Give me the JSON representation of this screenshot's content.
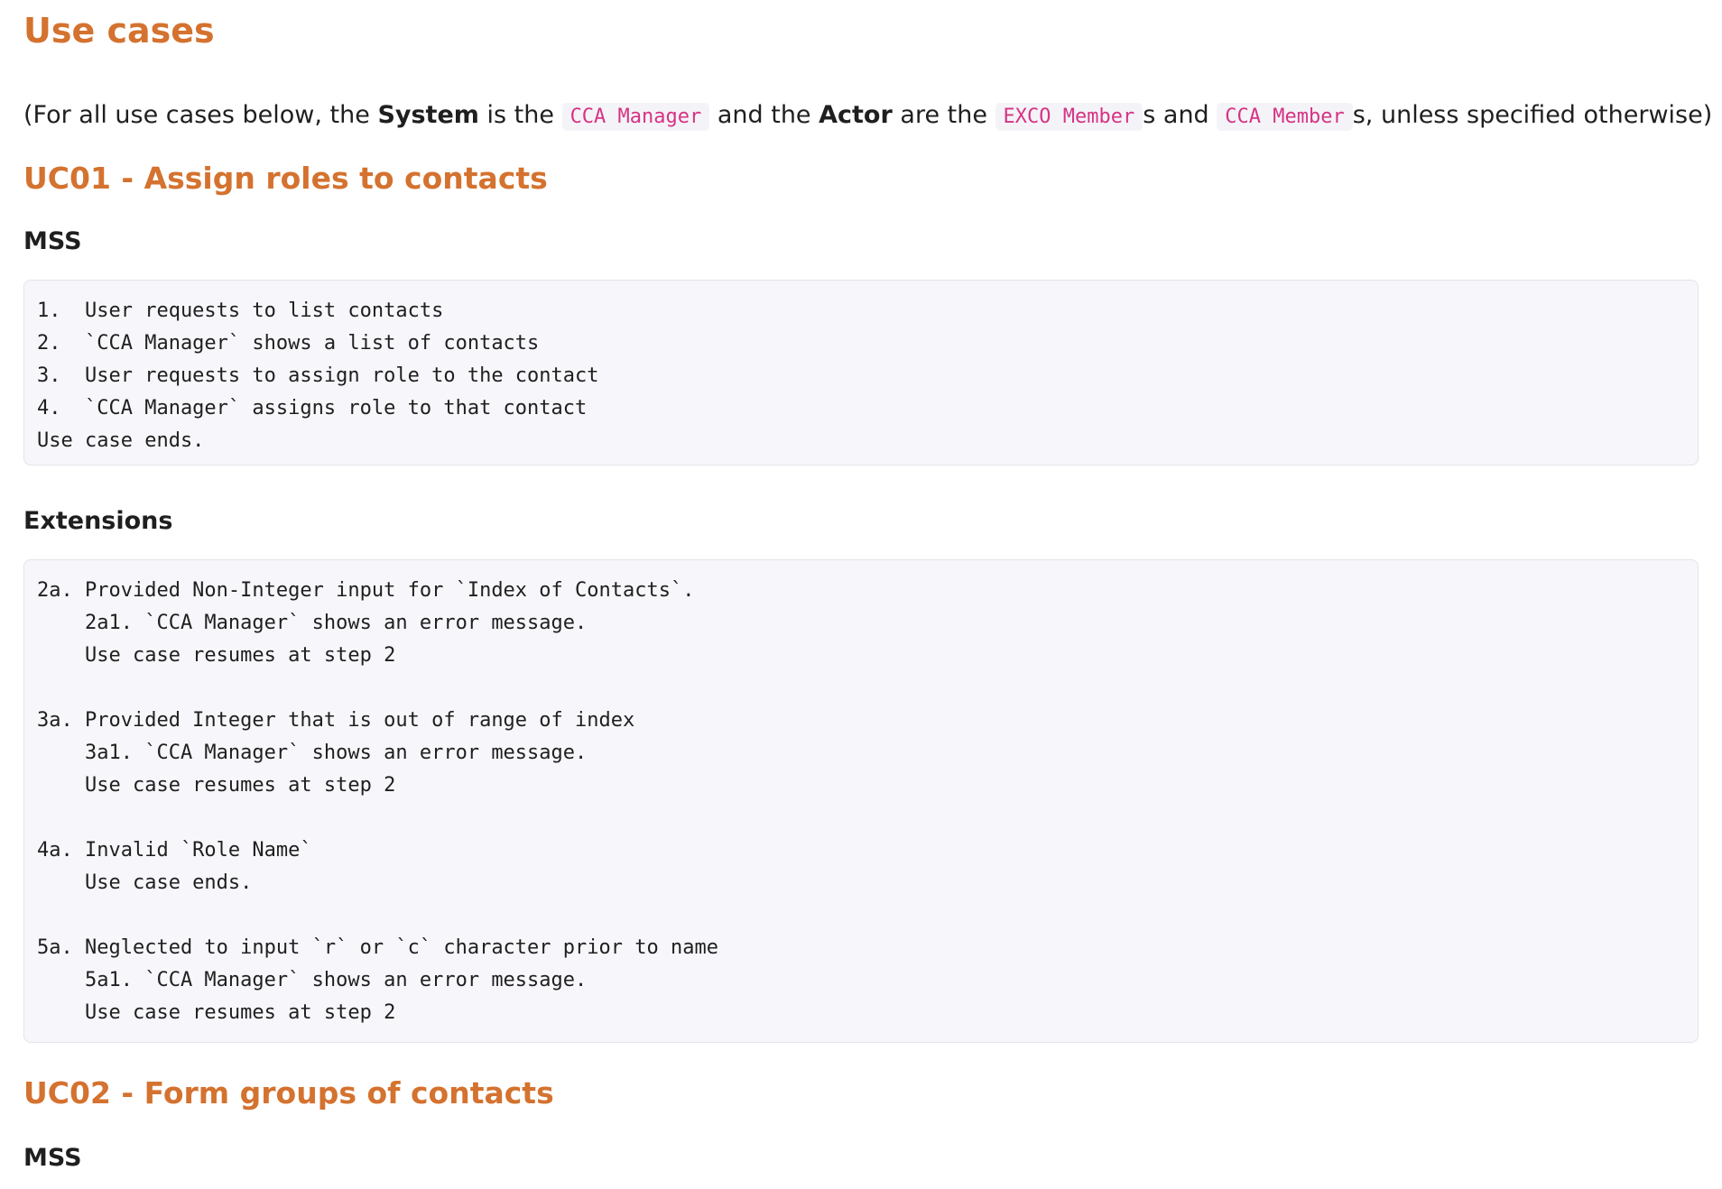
{
  "page": {
    "title": "Use cases",
    "intro": {
      "prefix": "(For all use cases below, the ",
      "system_word": "System",
      "is_the": " is the ",
      "system_code": "CCA Manager",
      "and_the": " and the ",
      "actor_word": "Actor",
      "are_the": " are the ",
      "actor_code_1": "EXCO Member",
      "s_and": "s and ",
      "actor_code_2": "CCA Member",
      "suffix": "s, unless specified otherwise)"
    }
  },
  "uc01": {
    "heading": "UC01 - Assign roles to contacts",
    "mss_heading": "MSS",
    "mss_lines": [
      "1.  User requests to list contacts",
      "2.  `CCA Manager` shows a list of contacts",
      "3.  User requests to assign role to the contact",
      "4.  `CCA Manager` assigns role to that contact",
      "Use case ends."
    ],
    "extensions_heading": "Extensions",
    "extensions": [
      {
        "title": "2a. Provided Non-Integer input for `Index of Contacts`.",
        "steps": [
          "    2a1. `CCA Manager` shows an error message.",
          "    Use case resumes at step 2"
        ]
      },
      {
        "title": "3a. Provided Integer that is out of range of index",
        "steps": [
          "    3a1. `CCA Manager` shows an error message.",
          "    Use case resumes at step 2"
        ]
      },
      {
        "title": "4a. Invalid `Role Name`",
        "steps": [
          "    Use case ends."
        ]
      },
      {
        "title": "5a. Neglected to input `r` or `c` character prior to name",
        "steps": [
          "    5a1. `CCA Manager` shows an error message.",
          "    Use case resumes at step 2"
        ]
      }
    ]
  },
  "uc02": {
    "heading": "UC02 - Form groups of contacts",
    "mss_heading": "MSS"
  },
  "colors": {
    "heading_accent": "#d4722f",
    "inline_code": "#d63384",
    "code_block_bg": "#f7f7fb"
  }
}
